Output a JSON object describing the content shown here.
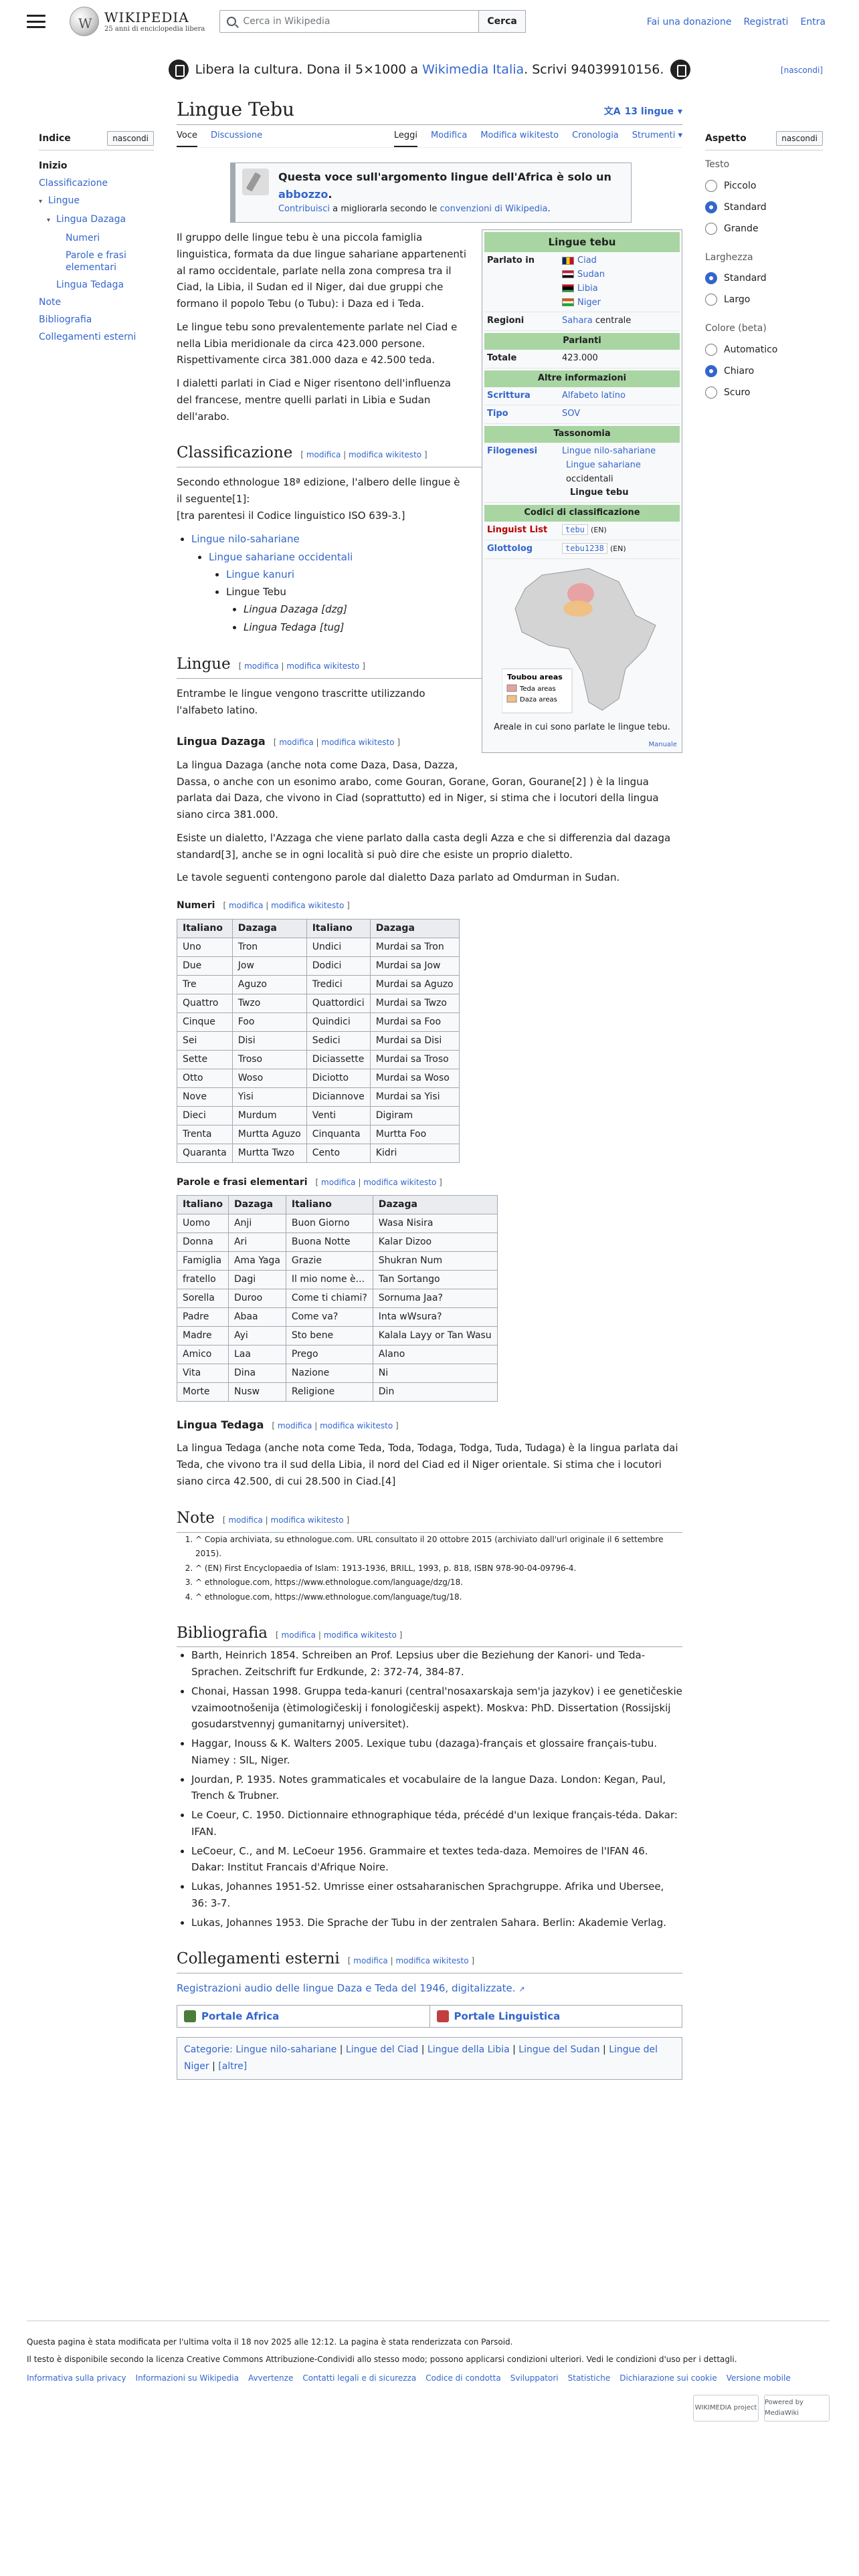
{
  "header": {
    "logo_title": "WIKIPEDIA",
    "logo_subtitle": "25 anni di enciclopedia libera",
    "search_placeholder": "Cerca in Wikipedia",
    "search_button": "Cerca",
    "links": [
      "Fai una donazione",
      "Registrati",
      "Entra"
    ]
  },
  "banner": {
    "text_prefix": "Libera la cultura. Dona il 5×1000 a",
    "link": "Wikimedia Italia",
    "text_suffix": ". Scrivi 94039910156.",
    "hide": "[nascondi]"
  },
  "toc": {
    "title": "Indice",
    "hide": "nascondi",
    "items": [
      {
        "label": "Inizio",
        "level": 1,
        "active": true
      },
      {
        "label": "Classificazione",
        "level": 1
      },
      {
        "label": "Lingue",
        "level": 1,
        "expanded": true
      },
      {
        "label": "Lingua Dazaga",
        "level": 2,
        "expanded": true
      },
      {
        "label": "Numeri",
        "level": 3
      },
      {
        "label": "Parole e frasi elementari",
        "level": 3
      },
      {
        "label": "Lingua Tedaga",
        "level": 2
      },
      {
        "label": "Note",
        "level": 1
      },
      {
        "label": "Bibliografia",
        "level": 1
      },
      {
        "label": "Collegamenti esterni",
        "level": 1
      }
    ]
  },
  "appearance": {
    "title": "Aspetto",
    "hide": "nascondi",
    "groups": [
      {
        "label": "Testo",
        "options": [
          "Piccolo",
          "Standard",
          "Grande"
        ],
        "selected": "Standard"
      },
      {
        "label": "Larghezza",
        "options": [
          "Standard",
          "Largo"
        ],
        "selected": "Standard"
      },
      {
        "label": "Colore (beta)",
        "options": [
          "Automatico",
          "Chiaro",
          "Scuro"
        ],
        "selected": "Chiaro"
      }
    ]
  },
  "article": {
    "title": "Lingue Tebu",
    "languages": "13 lingue",
    "tabs_left": [
      "Voce",
      "Discussione"
    ],
    "tabs_right": [
      "Leggi",
      "Modifica",
      "Modifica wikitesto",
      "Cronologia",
      "Strumenti"
    ],
    "stub_title": "Questa voce sull'argomento lingue dell'Africa è solo un",
    "stub_link": "abbozzo",
    "stub_body_link": "Contribuisci",
    "stub_body": "a migliorarla secondo le",
    "stub_body_link2": "convenzioni di Wikipedia",
    "edit": "modifica",
    "edit_wiki": "modifica wikitesto",
    "intro": [
      "Il gruppo delle lingue tebu è una piccola famiglia linguistica, formata da due lingue sahariane appartenenti al ramo occidentale, parlate nella zona compresa tra il Ciad, la Libia, il Sudan ed il Niger, dai due gruppi che formano il popolo Tebu (o Tubu): i Daza ed i Teda.",
      "Le lingue tebu sono prevalentemente parlate nel Ciad e nella Libia meridionale da circa 423.000 persone. Rispettivamente circa 381.000 daza e 42.500 teda.",
      "I dialetti parlati in Ciad e Niger risentono dell'influenza del francese, mentre quelli parlati in Libia e Sudan dell'arabo."
    ],
    "h_class": "Classificazione",
    "class_p": "Secondo ethnologue 18ª edizione, l'albero delle lingue è il seguente[1]:",
    "class_p2": "[tra parentesi il Codice linguistico ISO 639-3.]",
    "tree": {
      "l1": "Lingue nilo-sahariane",
      "l2": "Lingue sahariane occidentali",
      "l3a": "Lingue kanuri",
      "l3b": "Lingue Tebu",
      "l4a": "Lingua Dazaga [dzg]",
      "l4b": "Lingua Tedaga [tug]"
    },
    "h_lingue": "Lingue",
    "lingue_p": "Entrambe le lingue vengono trascritte utilizzando l'alfabeto latino.",
    "h_dazaga": "Lingua Dazaga",
    "dazaga_p1": "La lingua Dazaga (anche nota come Daza, Dasa, Dazza, Dassa, o anche con un esonimo arabo, come Gouran, Gorane, Goran, Gourane[2] ) è la lingua parlata dai Daza, che vivono in Ciad (soprattutto) ed in Niger, si stima che i locutori della lingua siano circa 381.000.",
    "dazaga_p2": "Esiste un dialetto, l'Azzaga che viene parlato dalla casta degli Azza e che si differenzia dal dazaga standard[3], anche se in ogni località si può dire che esiste un proprio dialetto.",
    "dazaga_p3": "Le tavole seguenti contengono parole dal dialetto Daza parlato ad Omdurman in Sudan.",
    "h_numeri": "Numeri",
    "h_parole": "Parole e frasi elementari",
    "h_tedaga": "Lingua Tedaga",
    "tedaga_p": "La lingua Tedaga (anche nota come Teda, Toda, Todaga, Todga, Tuda, Tudaga) è la lingua parlata dai Teda, che vivono tra il sud della Libia, il nord del Ciad ed il Niger orientale. Si stima che i locutori siano circa 42.500, di cui 28.500 in Ciad.[4]",
    "h_note": "Note",
    "notes": [
      "^ Copia archiviata, su ethnologue.com. URL consultato il 20 ottobre 2015 (archiviato dall'url originale il 6 settembre 2015).",
      "^ (EN) First Encyclopaedia of Islam: 1913-1936, BRILL, 1993, p. 818, ISBN 978-90-04-09796-4.",
      "^ ethnologue.com, https://www.ethnologue.com/language/dzg/18.",
      "^ ethnologue.com, https://www.ethnologue.com/language/tug/18."
    ],
    "h_bib": "Bibliografia",
    "bib": [
      "Barth, Heinrich 1854. Schreiben an Prof. Lepsius uber die Beziehung der Kanori- und Teda-Sprachen. Zeitschrift fur Erdkunde, 2: 372-74, 384-87.",
      "Chonai, Hassan 1998. Gruppa teda-kanuri (central'nosaxarskaja sem'ja jazykov) i ee genetičeskie vzaimootnošenija (ètimologičeskij i fonologičeskij aspekt). Moskva: PhD. Dissertation (Rossijskij gosudarstvennyj gumanitarnyj universitet).",
      "Haggar, Inouss & K. Walters 2005. Lexique tubu (dazaga)-français et glossaire français-tubu. Niamey : SIL, Niger.",
      "Jourdan, P. 1935. Notes grammaticales et vocabulaire de la langue Daza. London: Kegan, Paul, Trench & Trubner.",
      "Le Coeur, C. 1950. Dictionnaire ethnographique téda, précédé d'un lexique français-téda. Dakar: IFAN.",
      "LeCoeur, C., and M. LeCoeur 1956. Grammaire et textes teda-daza. Memoires de l'IFAN 46. Dakar: Institut Francais d'Afrique Noire.",
      "Lukas, Johannes 1951-52. Umrisse einer ostsaharanischen Sprachgruppe. Afrika und Ubersee, 36: 3-7.",
      "Lukas, Johannes 1953. Die Sprache der Tubu in der zentralen Sahara. Berlin: Akademie Verlag."
    ],
    "h_links": "Collegamenti esterni",
    "ext_link": "Registrazioni audio delle lingue Daza e Teda del 1946, digitalizzate.",
    "portals": [
      "Portale Africa",
      "Portale Linguistica"
    ],
    "categories_label": "Categorie:",
    "categories": [
      "Lingue nilo-sahariane",
      "Lingue del Ciad",
      "Lingue della Libia",
      "Lingue del Sudan",
      "Lingue del Niger",
      "[altre]"
    ]
  },
  "infobox": {
    "title": "Lingue tebu",
    "spoken_label": "Parlato in",
    "countries": [
      "Ciad",
      "Sudan",
      "Libia",
      "Niger"
    ],
    "regions_label": "Regioni",
    "regions_link": "Sahara",
    "regions_suffix": "centrale",
    "speakers_section": "Parlanti",
    "total_label": "Totale",
    "total_value": "423.000",
    "other_section": "Altre informazioni",
    "script_label": "Scrittura",
    "script_value": "Alfabeto latino",
    "type_label": "Tipo",
    "type_value": "SOV",
    "tax_section": "Tassonomia",
    "phylo_label": "Filogenesi",
    "phylo1": "Lingue nilo-sahariane",
    "phylo2": "Lingue sahariane",
    "phylo2_suffix": "occidentali",
    "phylo3": "Lingue tebu",
    "codes_section": "Codici di classificazione",
    "linguist_label": "Linguist List",
    "linguist_value": "tebu",
    "glotto_label": "Glottolog",
    "glotto_value": "tebu1238",
    "en_tag": "(EN)",
    "legend_title": "Toubou areas",
    "legend_items": [
      "Teda areas",
      "Daza areas"
    ],
    "legend_colors": [
      "#e8a0a0",
      "#f0c080"
    ],
    "caption": "Areale in cui sono parlate le lingue tebu.",
    "small": "Manuale"
  },
  "numbers_table": {
    "headers": [
      "Italiano",
      "Dazaga",
      "Italiano",
      "Dazaga"
    ],
    "rows": [
      [
        "Uno",
        "Tron",
        "Undici",
        "Murdai sa Tron"
      ],
      [
        "Due",
        "Jow",
        "Dodici",
        "Murdai sa Jow"
      ],
      [
        "Tre",
        "Aguzo",
        "Tredici",
        "Murdai sa Aguzo"
      ],
      [
        "Quattro",
        "Twzo",
        "Quattordici",
        "Murdai sa Twzo"
      ],
      [
        "Cinque",
        "Foo",
        "Quindici",
        "Murdai sa Foo"
      ],
      [
        "Sei",
        "Disi",
        "Sedici",
        "Murdai sa Disi"
      ],
      [
        "Sette",
        "Troso",
        "Diciassette",
        "Murdai sa Troso"
      ],
      [
        "Otto",
        "Woso",
        "Diciotto",
        "Murdai sa Woso"
      ],
      [
        "Nove",
        "Yisi",
        "Diciannove",
        "Murdai sa Yisi"
      ],
      [
        "Dieci",
        "Murdum",
        "Venti",
        "Digiram"
      ],
      [
        "Trenta",
        "Murtta Aguzo",
        "Cinquanta",
        "Murtta Foo"
      ],
      [
        "Quaranta",
        "Murtta Twzo",
        "Cento",
        "Kidri"
      ]
    ]
  },
  "phrases_table": {
    "headers": [
      "Italiano",
      "Dazaga",
      "Italiano",
      "Dazaga"
    ],
    "rows": [
      [
        "Uomo",
        "Anji",
        "Buon Giorno",
        "Wasa Nisira"
      ],
      [
        "Donna",
        "Ari",
        "Buona Notte",
        "Kalar Dizoo"
      ],
      [
        "Famiglia",
        "Ama Yaga",
        "Grazie",
        "Shukran Num"
      ],
      [
        "fratello",
        "Dagi",
        "Il mio nome è...",
        "Tan Sortango"
      ],
      [
        "Sorella",
        "Duroo",
        "Come ti chiami?",
        "Sornuma Jaa?"
      ],
      [
        "Padre",
        "Abaa",
        "Come va?",
        "Inta wWsura?"
      ],
      [
        "Madre",
        "Ayi",
        "Sto bene",
        "Kalala Layy or Tan Wasu"
      ],
      [
        "Amico",
        "Laa",
        "Prego",
        "Alano"
      ],
      [
        "Vita",
        "Dina",
        "Nazione",
        "Ni"
      ],
      [
        "Morte",
        "Nusw",
        "Religione",
        "Din"
      ]
    ]
  },
  "footer": {
    "modified": "Questa pagina è stata modificata per l'ultima volta il 18 nov 2025 alle 12:12. La pagina è stata renderizzata con Parsoid.",
    "license": "Il testo è disponibile secondo la licenza Creative Commons Attribuzione-Condividi allo stesso modo; possono applicarsi condizioni ulteriori. Vedi le condizioni d'uso per i dettagli.",
    "links": [
      "Informativa sulla privacy",
      "Informazioni su Wikipedia",
      "Avvertenze",
      "Contatti legali e di sicurezza",
      "Codice di condotta",
      "Sviluppatori",
      "Statistiche",
      "Dichiarazione sui cookie",
      "Versione mobile"
    ],
    "badges": [
      "WIKIMEDIA project",
      "Powered by MediaWiki"
    ]
  }
}
